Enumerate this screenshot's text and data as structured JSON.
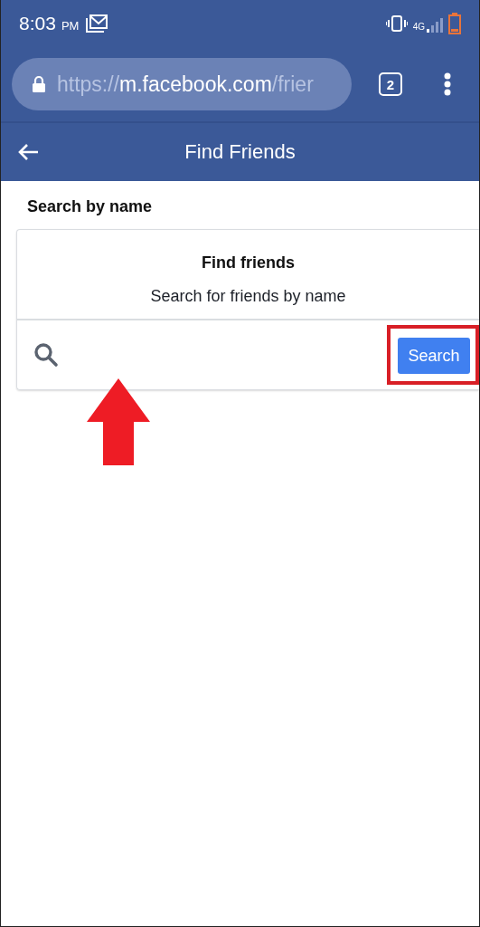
{
  "status_bar": {
    "time": "8:03",
    "period": "PM",
    "network": "4G"
  },
  "browser": {
    "url_parts": [
      {
        "text": "https://",
        "kind": "dim"
      },
      {
        "text": "m.facebook.com",
        "kind": "bright"
      },
      {
        "text": "/frier",
        "kind": "dim"
      }
    ],
    "tab_count": "2"
  },
  "header": {
    "title": "Find Friends"
  },
  "section_title": "Search by name",
  "card": {
    "title": "Find friends",
    "subtitle": "Search for friends by name",
    "button": "Search"
  }
}
